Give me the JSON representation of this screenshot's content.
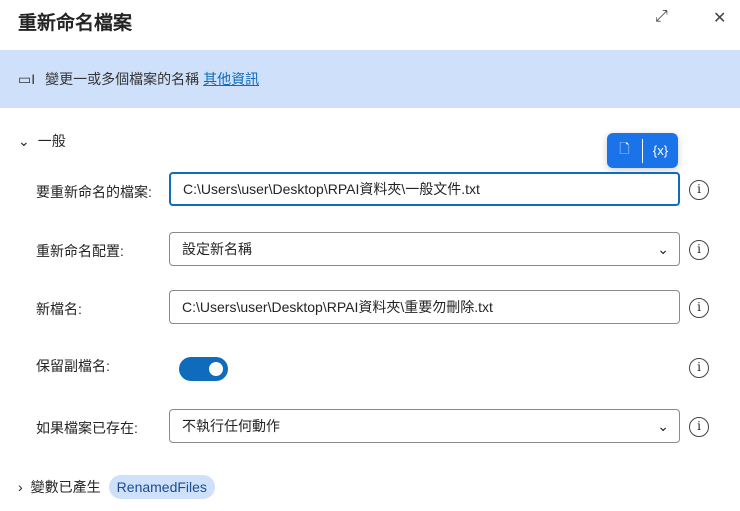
{
  "title": "重新命名檔案",
  "banner": {
    "text": "變更一或多個檔案的名稱",
    "link": "其他資訊"
  },
  "general": "一般",
  "fields": [
    {
      "label": "要重新命名的檔案:",
      "value": "C:\\Users\\user\\Desktop\\RPAI資料夾\\一般文件.txt"
    },
    {
      "label": "重新命名配置:",
      "value": "設定新名稱"
    },
    {
      "label": "新檔名:",
      "value": "C:\\Users\\user\\Desktop\\RPAI資料夾\\重要勿刪除.txt"
    },
    {
      "label": "保留副檔名:",
      "value": true
    },
    {
      "label": "如果檔案已存在:",
      "value": "不執行任何動作"
    }
  ],
  "popup": {
    "var_label": "{x}"
  },
  "variables": {
    "label": "變數已產生",
    "chip": "RenamedFiles"
  }
}
